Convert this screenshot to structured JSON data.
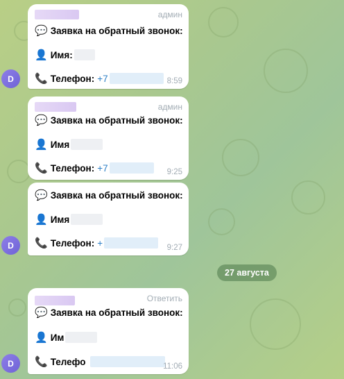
{
  "messages": [
    {
      "badge": "админ",
      "title": "Заявка на обратный звонок:",
      "name_label": "Имя:",
      "phone_label": "Телефон:",
      "phone_prefix": "+7",
      "time": "8:59"
    },
    {
      "badge": "админ",
      "title": "Заявка на обратный звонок:",
      "name_label": "Имя",
      "phone_label": "Телефон:",
      "phone_prefix": "+7",
      "time": "9:25"
    },
    {
      "title": "Заявка на обратный звонок:",
      "name_label": "Имя",
      "phone_label": "Телефон:",
      "phone_prefix": "+",
      "time": "9:27"
    },
    {
      "badge": "Ответить",
      "title": "Заявка на обратный звонок:",
      "name_label": "Им",
      "phone_label": "Телефо",
      "phone_prefix": "",
      "time": "11:06"
    }
  ],
  "avatar_letter": "D",
  "date_separator": "27 августа",
  "colors": {
    "avatar": "#7d6fe0",
    "link": "#2d7fc6",
    "date_pill": "#4c784a"
  },
  "icons": {
    "title": "speech-balloon-icon",
    "name": "bust-silhouette-icon",
    "phone": "telephone-receiver-icon"
  }
}
